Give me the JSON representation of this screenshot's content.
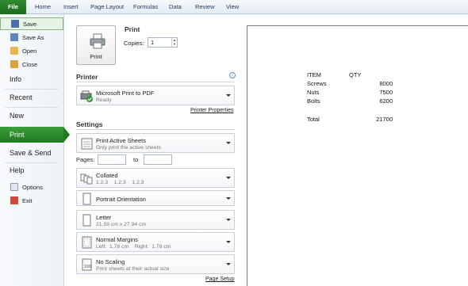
{
  "ribbon": {
    "tabs": [
      "File",
      "Home",
      "Insert",
      "Page Layout",
      "Formulas",
      "Data",
      "Review",
      "View"
    ]
  },
  "backstage": {
    "small_items": [
      "Save",
      "Save As",
      "Open",
      "Close"
    ],
    "big_items": [
      "Info",
      "Recent",
      "New",
      "Print",
      "Save & Send",
      "Help"
    ],
    "lower_items": [
      "Options",
      "Exit"
    ]
  },
  "print": {
    "title": "Print",
    "button_label": "Print",
    "copies_label": "Copies:",
    "copies_value": "1"
  },
  "printer": {
    "heading": "Printer",
    "name": "Microsoft Print to PDF",
    "status": "Ready",
    "properties_link": "Printer Properties"
  },
  "settings": {
    "heading": "Settings",
    "what": {
      "title": "Print Active Sheets",
      "sub": "Only print the active sheets"
    },
    "pages_label": "Pages:",
    "to_label": "to",
    "collation": {
      "title": "Collated",
      "sub": "1,2,3    1,2,3    1,2,3"
    },
    "orientation": {
      "title": "Portrait Orientation"
    },
    "paper": {
      "title": "Letter",
      "sub": "21.59 cm x 27.94 cm"
    },
    "margins": {
      "title": "Normal Margins",
      "sub": "Left:  1.78 cm    Right:  1.78 cm"
    },
    "scaling": {
      "title": "No Scaling",
      "sub": "Print sheets at their actual size"
    },
    "page_setup_link": "Page Setup"
  },
  "preview": {
    "headers": [
      "ITEM",
      "QTY"
    ],
    "rows": [
      {
        "item": "Screws",
        "qty": "8000"
      },
      {
        "item": "Nuts",
        "qty": "7500"
      },
      {
        "item": "Bolts",
        "qty": "6200"
      }
    ],
    "total_label": "Total",
    "total_value": "21700"
  },
  "colors": {
    "accent": "#207a20",
    "file_tab": "#1d6b1f"
  }
}
